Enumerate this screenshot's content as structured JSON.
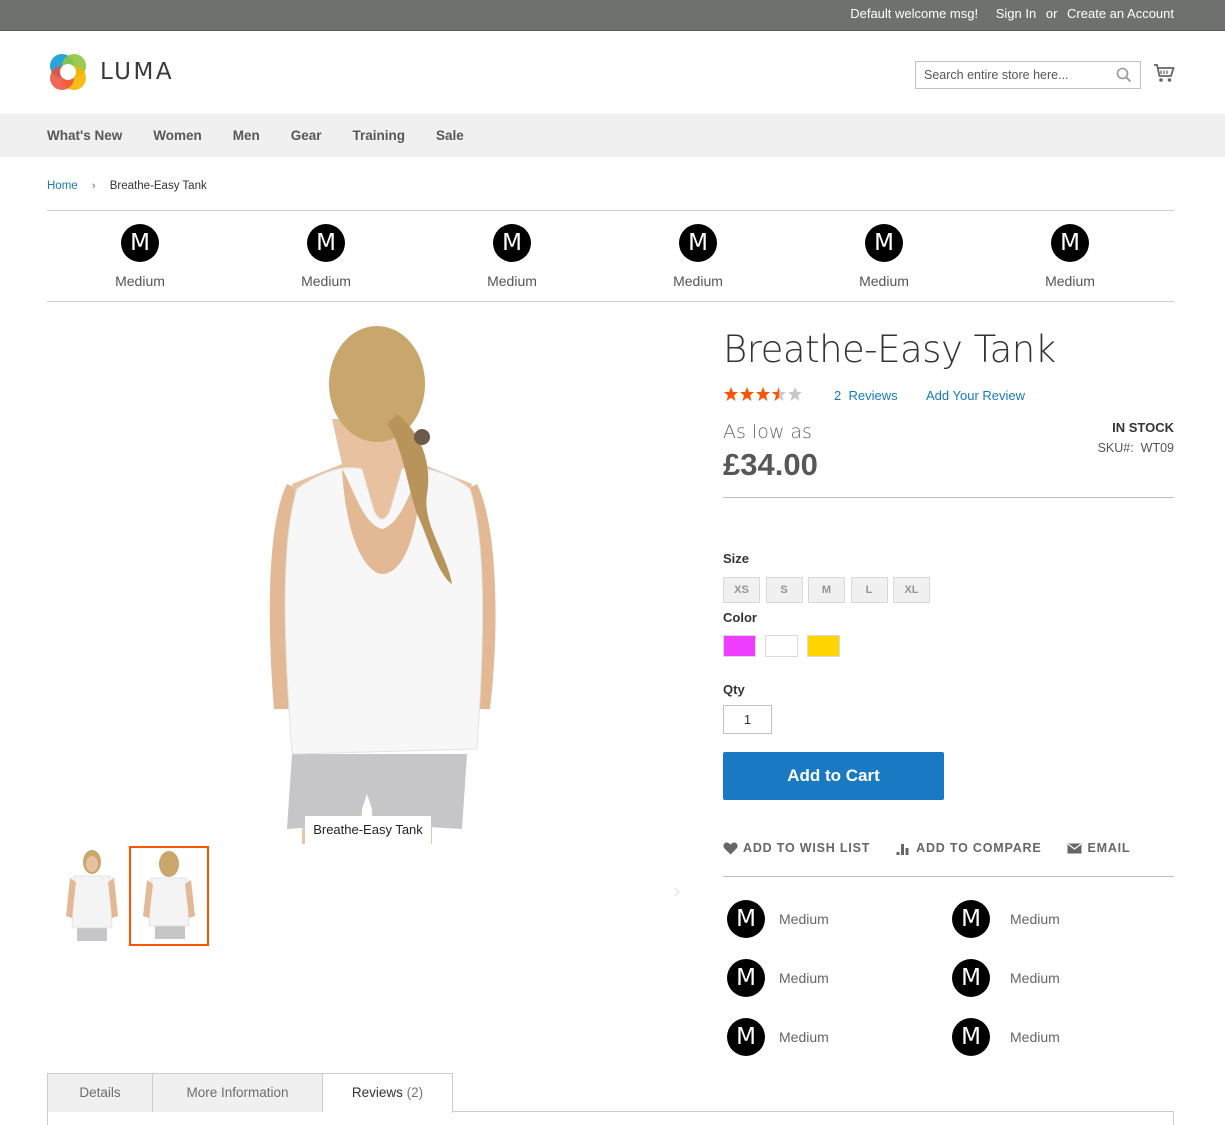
{
  "top_bar": {
    "welcome": "Default welcome msg!",
    "sign_in": "Sign In",
    "or": "or",
    "create_account": "Create an Account"
  },
  "header": {
    "logo_text": "LUMA",
    "search_placeholder": "Search entire store here...",
    "search_icon": "search-icon",
    "cart_icon": "cart-icon"
  },
  "nav": {
    "items": [
      "What's New",
      "Women",
      "Men",
      "Gear",
      "Training",
      "Sale"
    ]
  },
  "breadcrumb": {
    "home": "Home",
    "separator": "›",
    "current": "Breathe-Easy Tank"
  },
  "badges": {
    "letter": "M",
    "items": [
      "Medium",
      "Medium",
      "Medium",
      "Medium",
      "Medium",
      "Medium"
    ]
  },
  "gallery": {
    "caption": "Breathe-Easy Tank",
    "thumbnails": [
      "front",
      "back"
    ],
    "selected_thumbnail": 1
  },
  "product": {
    "title": "Breathe-Easy Tank",
    "rating": 3.5,
    "rating_max": 5,
    "reviews_count": "2",
    "reviews_label": "Reviews",
    "add_review": "Add Your Review",
    "as_low_as": "As low as",
    "price": "£34.00",
    "stock": "IN STOCK",
    "sku_label": "SKU#:",
    "sku": "WT09",
    "size_label": "Size",
    "sizes": [
      "XS",
      "S",
      "M",
      "L",
      "XL"
    ],
    "color_label": "Color",
    "colors": [
      "#ef3dff",
      "#ffffff",
      "#ffd500"
    ],
    "qty_label": "Qty",
    "qty": "1",
    "add_to_cart": "Add to Cart",
    "actions": {
      "wishlist": "ADD TO WISH LIST",
      "compare": "ADD TO COMPARE",
      "email": "EMAIL"
    }
  },
  "mini_badges": {
    "letter": "M",
    "items": [
      "Medium",
      "Medium",
      "Medium",
      "Medium",
      "Medium",
      "Medium"
    ]
  },
  "tabs": {
    "details": "Details",
    "more_info": "More Information",
    "reviews": "Reviews",
    "reviews_count": "(2)",
    "active": "reviews"
  },
  "colors": {
    "accent": "#1979c3",
    "star": "#ff5501",
    "top_bar": "#6e716e",
    "nav_bg": "#f0f0f0"
  }
}
